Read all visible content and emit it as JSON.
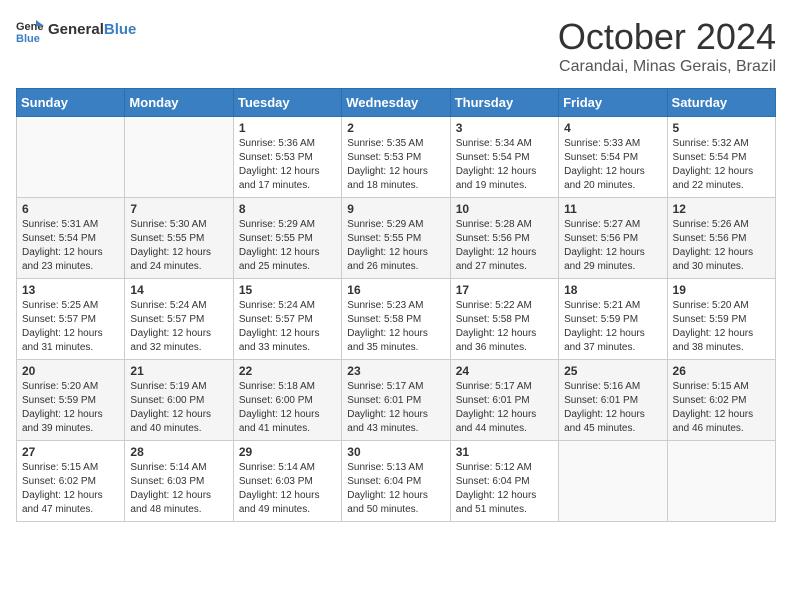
{
  "header": {
    "logo_general": "General",
    "logo_blue": "Blue",
    "month_year": "October 2024",
    "location": "Carandai, Minas Gerais, Brazil"
  },
  "days_of_week": [
    "Sunday",
    "Monday",
    "Tuesday",
    "Wednesday",
    "Thursday",
    "Friday",
    "Saturday"
  ],
  "weeks": [
    [
      {
        "day": "",
        "sunrise": "",
        "sunset": "",
        "daylight": ""
      },
      {
        "day": "",
        "sunrise": "",
        "sunset": "",
        "daylight": ""
      },
      {
        "day": "1",
        "sunrise": "Sunrise: 5:36 AM",
        "sunset": "Sunset: 5:53 PM",
        "daylight": "Daylight: 12 hours and 17 minutes."
      },
      {
        "day": "2",
        "sunrise": "Sunrise: 5:35 AM",
        "sunset": "Sunset: 5:53 PM",
        "daylight": "Daylight: 12 hours and 18 minutes."
      },
      {
        "day": "3",
        "sunrise": "Sunrise: 5:34 AM",
        "sunset": "Sunset: 5:54 PM",
        "daylight": "Daylight: 12 hours and 19 minutes."
      },
      {
        "day": "4",
        "sunrise": "Sunrise: 5:33 AM",
        "sunset": "Sunset: 5:54 PM",
        "daylight": "Daylight: 12 hours and 20 minutes."
      },
      {
        "day": "5",
        "sunrise": "Sunrise: 5:32 AM",
        "sunset": "Sunset: 5:54 PM",
        "daylight": "Daylight: 12 hours and 22 minutes."
      }
    ],
    [
      {
        "day": "6",
        "sunrise": "Sunrise: 5:31 AM",
        "sunset": "Sunset: 5:54 PM",
        "daylight": "Daylight: 12 hours and 23 minutes."
      },
      {
        "day": "7",
        "sunrise": "Sunrise: 5:30 AM",
        "sunset": "Sunset: 5:55 PM",
        "daylight": "Daylight: 12 hours and 24 minutes."
      },
      {
        "day": "8",
        "sunrise": "Sunrise: 5:29 AM",
        "sunset": "Sunset: 5:55 PM",
        "daylight": "Daylight: 12 hours and 25 minutes."
      },
      {
        "day": "9",
        "sunrise": "Sunrise: 5:29 AM",
        "sunset": "Sunset: 5:55 PM",
        "daylight": "Daylight: 12 hours and 26 minutes."
      },
      {
        "day": "10",
        "sunrise": "Sunrise: 5:28 AM",
        "sunset": "Sunset: 5:56 PM",
        "daylight": "Daylight: 12 hours and 27 minutes."
      },
      {
        "day": "11",
        "sunrise": "Sunrise: 5:27 AM",
        "sunset": "Sunset: 5:56 PM",
        "daylight": "Daylight: 12 hours and 29 minutes."
      },
      {
        "day": "12",
        "sunrise": "Sunrise: 5:26 AM",
        "sunset": "Sunset: 5:56 PM",
        "daylight": "Daylight: 12 hours and 30 minutes."
      }
    ],
    [
      {
        "day": "13",
        "sunrise": "Sunrise: 5:25 AM",
        "sunset": "Sunset: 5:57 PM",
        "daylight": "Daylight: 12 hours and 31 minutes."
      },
      {
        "day": "14",
        "sunrise": "Sunrise: 5:24 AM",
        "sunset": "Sunset: 5:57 PM",
        "daylight": "Daylight: 12 hours and 32 minutes."
      },
      {
        "day": "15",
        "sunrise": "Sunrise: 5:24 AM",
        "sunset": "Sunset: 5:57 PM",
        "daylight": "Daylight: 12 hours and 33 minutes."
      },
      {
        "day": "16",
        "sunrise": "Sunrise: 5:23 AM",
        "sunset": "Sunset: 5:58 PM",
        "daylight": "Daylight: 12 hours and 35 minutes."
      },
      {
        "day": "17",
        "sunrise": "Sunrise: 5:22 AM",
        "sunset": "Sunset: 5:58 PM",
        "daylight": "Daylight: 12 hours and 36 minutes."
      },
      {
        "day": "18",
        "sunrise": "Sunrise: 5:21 AM",
        "sunset": "Sunset: 5:59 PM",
        "daylight": "Daylight: 12 hours and 37 minutes."
      },
      {
        "day": "19",
        "sunrise": "Sunrise: 5:20 AM",
        "sunset": "Sunset: 5:59 PM",
        "daylight": "Daylight: 12 hours and 38 minutes."
      }
    ],
    [
      {
        "day": "20",
        "sunrise": "Sunrise: 5:20 AM",
        "sunset": "Sunset: 5:59 PM",
        "daylight": "Daylight: 12 hours and 39 minutes."
      },
      {
        "day": "21",
        "sunrise": "Sunrise: 5:19 AM",
        "sunset": "Sunset: 6:00 PM",
        "daylight": "Daylight: 12 hours and 40 minutes."
      },
      {
        "day": "22",
        "sunrise": "Sunrise: 5:18 AM",
        "sunset": "Sunset: 6:00 PM",
        "daylight": "Daylight: 12 hours and 41 minutes."
      },
      {
        "day": "23",
        "sunrise": "Sunrise: 5:17 AM",
        "sunset": "Sunset: 6:01 PM",
        "daylight": "Daylight: 12 hours and 43 minutes."
      },
      {
        "day": "24",
        "sunrise": "Sunrise: 5:17 AM",
        "sunset": "Sunset: 6:01 PM",
        "daylight": "Daylight: 12 hours and 44 minutes."
      },
      {
        "day": "25",
        "sunrise": "Sunrise: 5:16 AM",
        "sunset": "Sunset: 6:01 PM",
        "daylight": "Daylight: 12 hours and 45 minutes."
      },
      {
        "day": "26",
        "sunrise": "Sunrise: 5:15 AM",
        "sunset": "Sunset: 6:02 PM",
        "daylight": "Daylight: 12 hours and 46 minutes."
      }
    ],
    [
      {
        "day": "27",
        "sunrise": "Sunrise: 5:15 AM",
        "sunset": "Sunset: 6:02 PM",
        "daylight": "Daylight: 12 hours and 47 minutes."
      },
      {
        "day": "28",
        "sunrise": "Sunrise: 5:14 AM",
        "sunset": "Sunset: 6:03 PM",
        "daylight": "Daylight: 12 hours and 48 minutes."
      },
      {
        "day": "29",
        "sunrise": "Sunrise: 5:14 AM",
        "sunset": "Sunset: 6:03 PM",
        "daylight": "Daylight: 12 hours and 49 minutes."
      },
      {
        "day": "30",
        "sunrise": "Sunrise: 5:13 AM",
        "sunset": "Sunset: 6:04 PM",
        "daylight": "Daylight: 12 hours and 50 minutes."
      },
      {
        "day": "31",
        "sunrise": "Sunrise: 5:12 AM",
        "sunset": "Sunset: 6:04 PM",
        "daylight": "Daylight: 12 hours and 51 minutes."
      },
      {
        "day": "",
        "sunrise": "",
        "sunset": "",
        "daylight": ""
      },
      {
        "day": "",
        "sunrise": "",
        "sunset": "",
        "daylight": ""
      }
    ]
  ]
}
